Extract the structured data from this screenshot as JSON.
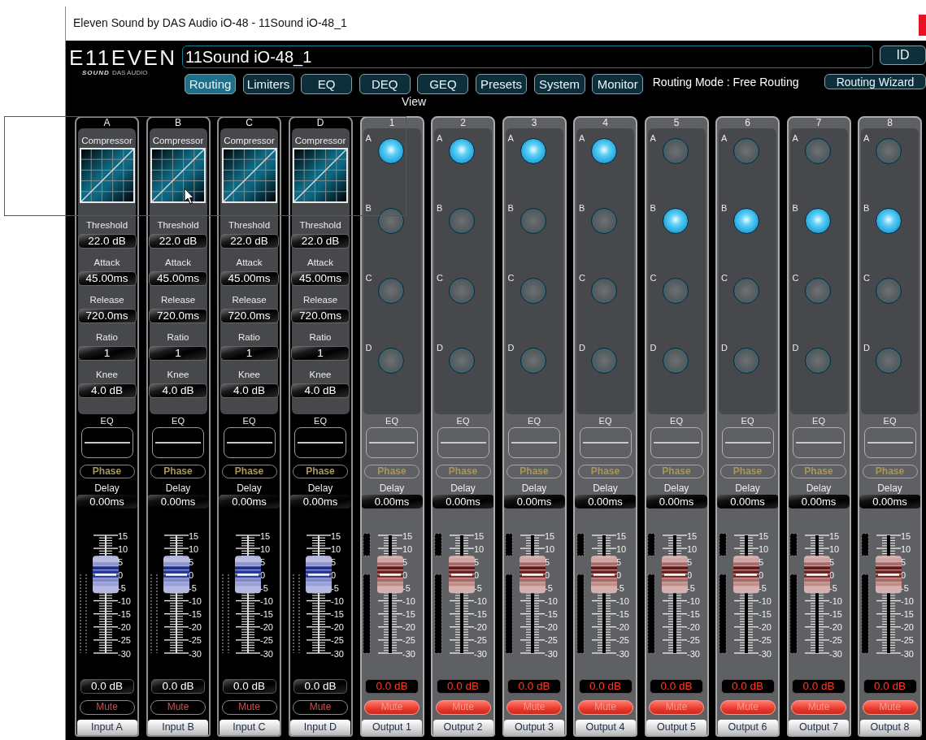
{
  "window": {
    "title": "Eleven Sound by DAS Audio iO-48 - 11Sound iO-48_1"
  },
  "header": {
    "logo": {
      "wordmark": "E11EVEN",
      "subtitle": "SOUND",
      "maker": "DAS AUDIO"
    },
    "device_name": "11Sound iO-48_1",
    "id_button": "ID"
  },
  "tabs": [
    {
      "label": "Routing",
      "selected": true
    },
    {
      "label": "Limiters",
      "selected": false
    },
    {
      "label": "EQ",
      "selected": false
    },
    {
      "label": "DEQ",
      "selected": false
    },
    {
      "label": "GEQ",
      "selected": false
    },
    {
      "label": "Presets",
      "selected": false
    },
    {
      "label": "System",
      "selected": false
    },
    {
      "label": "Monitor",
      "selected": false
    }
  ],
  "tabs_caption": "View",
  "routing_mode": "Routing Mode : Free Routing",
  "routing_wizard_button": "Routing Wizard",
  "channels": [
    {
      "kind": "input",
      "header": "A",
      "compressor": {
        "title": "Compressor",
        "params": [
          {
            "label": "Threshold",
            "value": "22.0 dB"
          },
          {
            "label": "Attack",
            "value": "45.00ms"
          },
          {
            "label": "Release",
            "value": "720.0ms"
          },
          {
            "label": "Ratio",
            "value": "1"
          },
          {
            "label": "Knee",
            "value": "4.0 dB"
          }
        ]
      },
      "eq_label": "EQ",
      "phase": "Phase",
      "delay_label": "Delay",
      "delay": "0.00ms",
      "scale": [
        "15",
        "10",
        "5",
        "0",
        "-5",
        "-10",
        "-15",
        "-20",
        "-25",
        "-30"
      ],
      "level": 0.667,
      "gain": "0.0 dB",
      "mute": "Mute",
      "muted": false,
      "name": "Input A"
    },
    {
      "kind": "input",
      "header": "B",
      "compressor": {
        "title": "Compressor",
        "params": [
          {
            "label": "Threshold",
            "value": "22.0 dB"
          },
          {
            "label": "Attack",
            "value": "45.00ms"
          },
          {
            "label": "Release",
            "value": "720.0ms"
          },
          {
            "label": "Ratio",
            "value": "1"
          },
          {
            "label": "Knee",
            "value": "4.0 dB"
          }
        ]
      },
      "eq_label": "EQ",
      "phase": "Phase",
      "delay_label": "Delay",
      "delay": "0.00ms",
      "scale": [
        "15",
        "10",
        "5",
        "0",
        "-5",
        "-10",
        "-15",
        "-20",
        "-25",
        "-30"
      ],
      "level": 0.667,
      "gain": "0.0 dB",
      "mute": "Mute",
      "muted": false,
      "name": "Input B"
    },
    {
      "kind": "input",
      "header": "C",
      "compressor": {
        "title": "Compressor",
        "params": [
          {
            "label": "Threshold",
            "value": "22.0 dB"
          },
          {
            "label": "Attack",
            "value": "45.00ms"
          },
          {
            "label": "Release",
            "value": "720.0ms"
          },
          {
            "label": "Ratio",
            "value": "1"
          },
          {
            "label": "Knee",
            "value": "4.0 dB"
          }
        ]
      },
      "eq_label": "EQ",
      "phase": "Phase",
      "delay_label": "Delay",
      "delay": "0.00ms",
      "scale": [
        "15",
        "10",
        "5",
        "0",
        "-5",
        "-10",
        "-15",
        "-20",
        "-25",
        "-30"
      ],
      "level": 0.667,
      "gain": "0.0 dB",
      "mute": "Mute",
      "muted": false,
      "name": "Input C"
    },
    {
      "kind": "input",
      "header": "D",
      "compressor": {
        "title": "Compressor",
        "params": [
          {
            "label": "Threshold",
            "value": "22.0 dB"
          },
          {
            "label": "Attack",
            "value": "45.00ms"
          },
          {
            "label": "Release",
            "value": "720.0ms"
          },
          {
            "label": "Ratio",
            "value": "1"
          },
          {
            "label": "Knee",
            "value": "4.0 dB"
          }
        ]
      },
      "eq_label": "EQ",
      "phase": "Phase",
      "delay_label": "Delay",
      "delay": "0.00ms",
      "scale": [
        "15",
        "10",
        "5",
        "0",
        "-5",
        "-10",
        "-15",
        "-20",
        "-25",
        "-30"
      ],
      "level": 0.667,
      "gain": "0.0 dB",
      "mute": "Mute",
      "muted": false,
      "name": "Input D"
    },
    {
      "kind": "output",
      "header": "1",
      "routes": [
        {
          "label": "A",
          "on": true
        },
        {
          "label": "B",
          "on": false
        },
        {
          "label": "C",
          "on": false
        },
        {
          "label": "D",
          "on": false
        }
      ],
      "eq_label": "EQ",
      "phase": "Phase",
      "delay_label": "Delay",
      "delay": "0.00ms",
      "scale": [
        "15",
        "10",
        "5",
        "0",
        "-5",
        "-10",
        "-15",
        "-20",
        "-25",
        "-30"
      ],
      "level": 0.667,
      "gain": "0.0 dB",
      "mute": "Mute",
      "muted": true,
      "name": "Output 1"
    },
    {
      "kind": "output",
      "header": "2",
      "routes": [
        {
          "label": "A",
          "on": true
        },
        {
          "label": "B",
          "on": false
        },
        {
          "label": "C",
          "on": false
        },
        {
          "label": "D",
          "on": false
        }
      ],
      "eq_label": "EQ",
      "phase": "Phase",
      "delay_label": "Delay",
      "delay": "0.00ms",
      "scale": [
        "15",
        "10",
        "5",
        "0",
        "-5",
        "-10",
        "-15",
        "-20",
        "-25",
        "-30"
      ],
      "level": 0.667,
      "gain": "0.0 dB",
      "mute": "Mute",
      "muted": true,
      "name": "Output 2"
    },
    {
      "kind": "output",
      "header": "3",
      "routes": [
        {
          "label": "A",
          "on": true
        },
        {
          "label": "B",
          "on": false
        },
        {
          "label": "C",
          "on": false
        },
        {
          "label": "D",
          "on": false
        }
      ],
      "eq_label": "EQ",
      "phase": "Phase",
      "delay_label": "Delay",
      "delay": "0.00ms",
      "scale": [
        "15",
        "10",
        "5",
        "0",
        "-5",
        "-10",
        "-15",
        "-20",
        "-25",
        "-30"
      ],
      "level": 0.667,
      "gain": "0.0 dB",
      "mute": "Mute",
      "muted": true,
      "name": "Output 3"
    },
    {
      "kind": "output",
      "header": "4",
      "routes": [
        {
          "label": "A",
          "on": true
        },
        {
          "label": "B",
          "on": false
        },
        {
          "label": "C",
          "on": false
        },
        {
          "label": "D",
          "on": false
        }
      ],
      "eq_label": "EQ",
      "phase": "Phase",
      "delay_label": "Delay",
      "delay": "0.00ms",
      "scale": [
        "15",
        "10",
        "5",
        "0",
        "-5",
        "-10",
        "-15",
        "-20",
        "-25",
        "-30"
      ],
      "level": 0.667,
      "gain": "0.0 dB",
      "mute": "Mute",
      "muted": true,
      "name": "Output 4"
    },
    {
      "kind": "output",
      "header": "5",
      "routes": [
        {
          "label": "A",
          "on": false
        },
        {
          "label": "B",
          "on": true
        },
        {
          "label": "C",
          "on": false
        },
        {
          "label": "D",
          "on": false
        }
      ],
      "eq_label": "EQ",
      "phase": "Phase",
      "delay_label": "Delay",
      "delay": "0.00ms",
      "scale": [
        "15",
        "10",
        "5",
        "0",
        "-5",
        "-10",
        "-15",
        "-20",
        "-25",
        "-30"
      ],
      "level": 0.667,
      "gain": "0.0 dB",
      "mute": "Mute",
      "muted": true,
      "name": "Output 5"
    },
    {
      "kind": "output",
      "header": "6",
      "routes": [
        {
          "label": "A",
          "on": false
        },
        {
          "label": "B",
          "on": true
        },
        {
          "label": "C",
          "on": false
        },
        {
          "label": "D",
          "on": false
        }
      ],
      "eq_label": "EQ",
      "phase": "Phase",
      "delay_label": "Delay",
      "delay": "0.00ms",
      "scale": [
        "15",
        "10",
        "5",
        "0",
        "-5",
        "-10",
        "-15",
        "-20",
        "-25",
        "-30"
      ],
      "level": 0.667,
      "gain": "0.0 dB",
      "mute": "Mute",
      "muted": true,
      "name": "Output 6"
    },
    {
      "kind": "output",
      "header": "7",
      "routes": [
        {
          "label": "A",
          "on": false
        },
        {
          "label": "B",
          "on": true
        },
        {
          "label": "C",
          "on": false
        },
        {
          "label": "D",
          "on": false
        }
      ],
      "eq_label": "EQ",
      "phase": "Phase",
      "delay_label": "Delay",
      "delay": "0.00ms",
      "scale": [
        "15",
        "10",
        "5",
        "0",
        "-5",
        "-10",
        "-15",
        "-20",
        "-25",
        "-30"
      ],
      "level": 0.667,
      "gain": "0.0 dB",
      "mute": "Mute",
      "muted": true,
      "name": "Output 7"
    },
    {
      "kind": "output",
      "header": "8",
      "routes": [
        {
          "label": "A",
          "on": false
        },
        {
          "label": "B",
          "on": true
        },
        {
          "label": "C",
          "on": false
        },
        {
          "label": "D",
          "on": false
        }
      ],
      "eq_label": "EQ",
      "phase": "Phase",
      "delay_label": "Delay",
      "delay": "0.00ms",
      "scale": [
        "15",
        "10",
        "5",
        "0",
        "-5",
        "-10",
        "-15",
        "-20",
        "-25",
        "-30"
      ],
      "level": 0.667,
      "gain": "0.0 dB",
      "mute": "Mute",
      "muted": true,
      "name": "Output 8"
    }
  ]
}
